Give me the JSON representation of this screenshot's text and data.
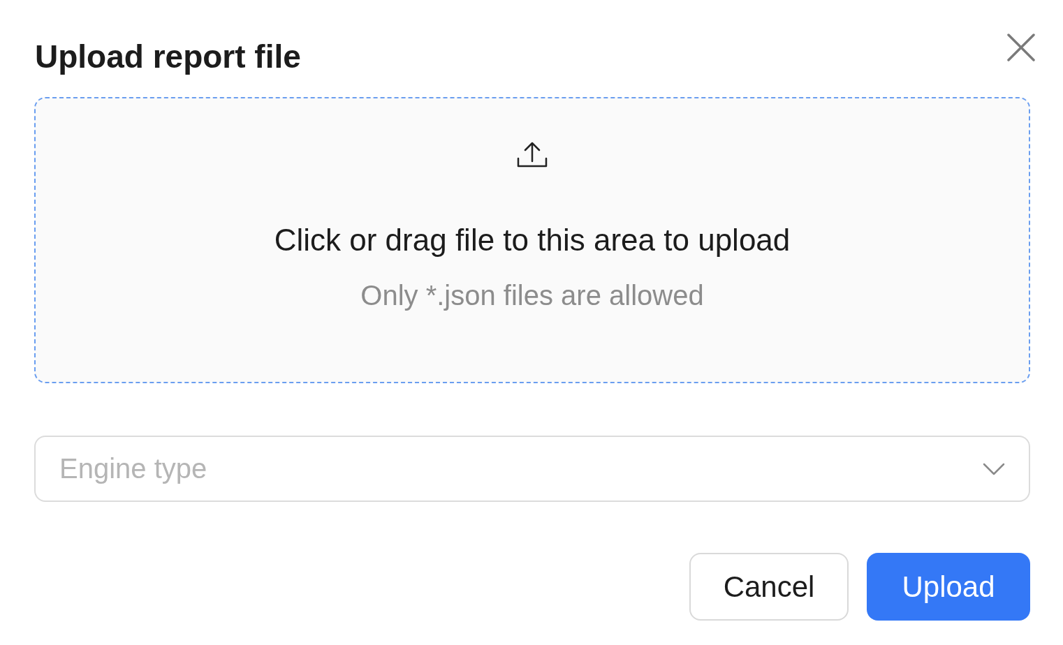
{
  "dialog": {
    "title": "Upload report file"
  },
  "dropzone": {
    "text": "Click or drag file to this area to upload",
    "hint": "Only *.json files are allowed"
  },
  "select": {
    "placeholder": "Engine type"
  },
  "buttons": [
    {
      "label": "Cancel",
      "kind": "default"
    },
    {
      "label": "Upload",
      "kind": "primary"
    }
  ]
}
